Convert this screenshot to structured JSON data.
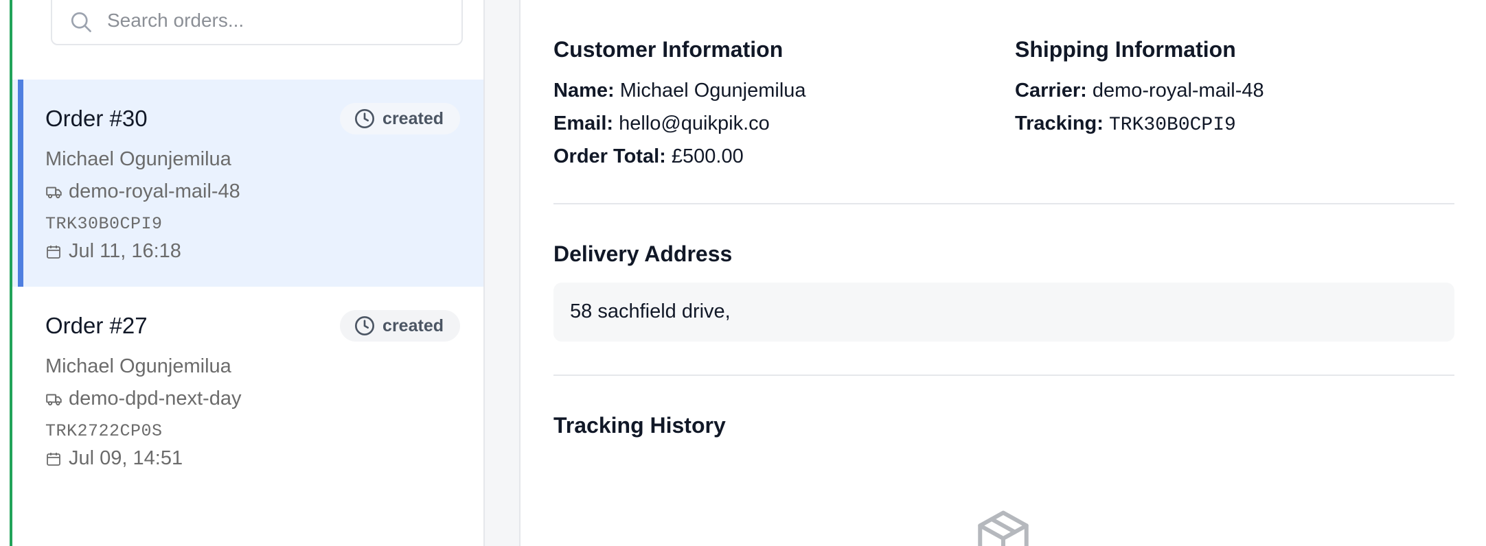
{
  "search": {
    "placeholder": "Search orders..."
  },
  "orders": [
    {
      "title": "Order #30",
      "status": "created",
      "customer": "Michael Ogunjemilua",
      "carrier": "demo-royal-mail-48",
      "tracking": "TRK30B0CPI9",
      "date": "Jul 11, 16:18",
      "selected": true
    },
    {
      "title": "Order #27",
      "status": "created",
      "customer": "Michael Ogunjemilua",
      "carrier": "demo-dpd-next-day",
      "tracking": "TRK2722CP0S",
      "date": "Jul 09, 14:51",
      "selected": false
    }
  ],
  "details": {
    "customer_heading": "Customer Information",
    "name_label": "Name:",
    "name_value": "Michael Ogunjemilua",
    "email_label": "Email:",
    "email_value": "hello@quikpik.co",
    "total_label": "Order Total:",
    "total_value": "£500.00",
    "shipping_heading": "Shipping Information",
    "carrier_label": "Carrier:",
    "carrier_value": "demo-royal-mail-48",
    "tracking_label": "Tracking:",
    "tracking_value": "TRK30B0CPI9",
    "address_heading": "Delivery Address",
    "address_value": "58 sachfield drive,",
    "history_heading": "Tracking History"
  },
  "icons": {
    "search": "search-icon",
    "status": "clock-icon",
    "carrier": "truck-icon",
    "date": "calendar-icon",
    "empty_history": "package-icon"
  },
  "colors": {
    "selected_bg": "#eaf2fe",
    "selected_accent": "#4f7fe0",
    "left_edge": "#22a35a",
    "muted_text": "#6b6b6b"
  }
}
